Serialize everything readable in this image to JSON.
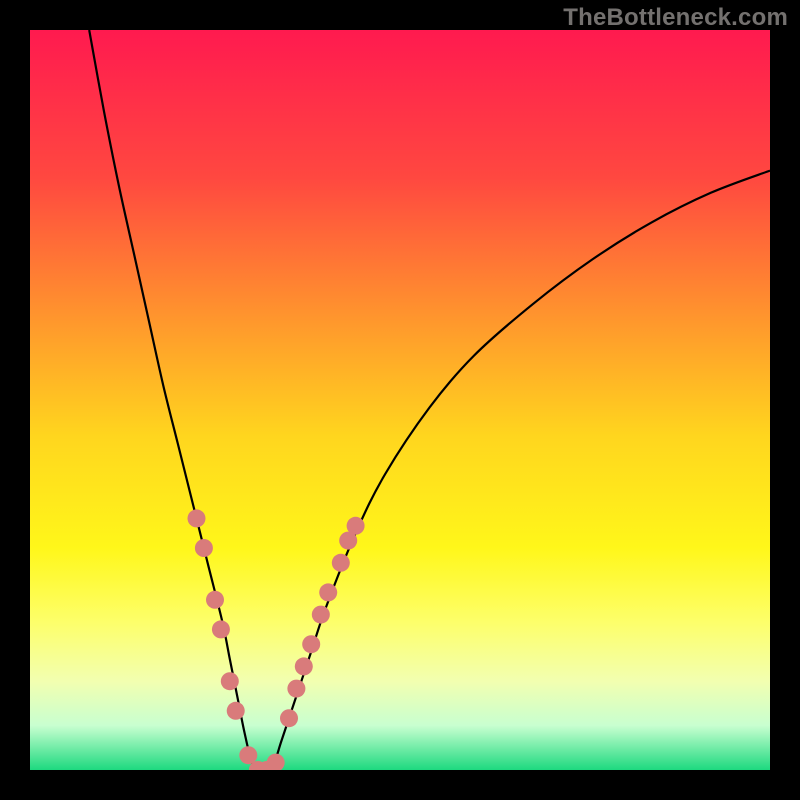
{
  "watermark": "TheBottleneck.com",
  "chart_data": {
    "type": "line",
    "title": "",
    "xlabel": "",
    "ylabel": "",
    "xlim": [
      0,
      100
    ],
    "ylim": [
      0,
      100
    ],
    "background": {
      "type": "vertical-gradient",
      "stops": [
        {
          "pos": 0.0,
          "color": "#ff1a4f"
        },
        {
          "pos": 0.2,
          "color": "#ff4840"
        },
        {
          "pos": 0.4,
          "color": "#ff9a2c"
        },
        {
          "pos": 0.55,
          "color": "#ffd61e"
        },
        {
          "pos": 0.7,
          "color": "#fff71a"
        },
        {
          "pos": 0.8,
          "color": "#fdff6a"
        },
        {
          "pos": 0.88,
          "color": "#f2ffb0"
        },
        {
          "pos": 0.94,
          "color": "#c8ffd0"
        },
        {
          "pos": 1.0,
          "color": "#1dd97f"
        }
      ]
    },
    "series": [
      {
        "name": "bottleneck-curve",
        "color": "#000000",
        "x": [
          8,
          10,
          12,
          14,
          16,
          18,
          20,
          22,
          24,
          26,
          27,
          28,
          29,
          30,
          31,
          32,
          33,
          34,
          36,
          38,
          40,
          44,
          48,
          54,
          60,
          68,
          76,
          84,
          92,
          100
        ],
        "y": [
          100,
          89,
          79,
          70,
          61,
          52,
          44,
          36,
          28,
          20,
          15,
          10,
          5,
          1,
          0,
          0,
          1,
          4,
          10,
          16,
          22,
          32,
          40,
          49,
          56,
          63,
          69,
          74,
          78,
          81
        ]
      }
    ],
    "markers": {
      "name": "dots",
      "color": "#d97b7b",
      "radius_px": 9,
      "points": [
        {
          "x": 22.5,
          "y": 34
        },
        {
          "x": 23.5,
          "y": 30
        },
        {
          "x": 25.0,
          "y": 23
        },
        {
          "x": 25.8,
          "y": 19
        },
        {
          "x": 27.0,
          "y": 12
        },
        {
          "x": 27.8,
          "y": 8
        },
        {
          "x": 29.5,
          "y": 2
        },
        {
          "x": 30.8,
          "y": 0
        },
        {
          "x": 32.0,
          "y": 0
        },
        {
          "x": 33.2,
          "y": 1
        },
        {
          "x": 35.0,
          "y": 7
        },
        {
          "x": 36.0,
          "y": 11
        },
        {
          "x": 37.0,
          "y": 14
        },
        {
          "x": 38.0,
          "y": 17
        },
        {
          "x": 39.3,
          "y": 21
        },
        {
          "x": 40.3,
          "y": 24
        },
        {
          "x": 42.0,
          "y": 28
        },
        {
          "x": 43.0,
          "y": 31
        },
        {
          "x": 44.0,
          "y": 33
        }
      ]
    }
  }
}
